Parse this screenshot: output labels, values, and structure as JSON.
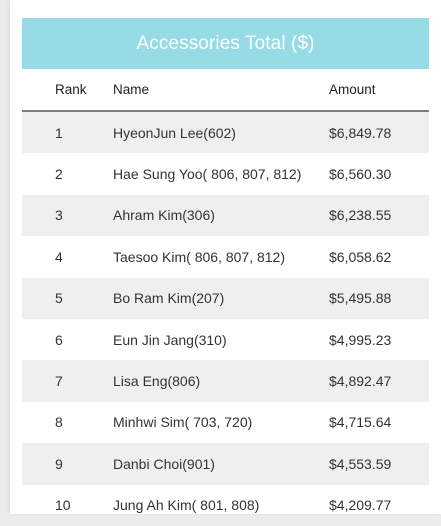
{
  "title": "Accessories Total ($)",
  "columns": {
    "rank": "Rank",
    "name": "Name",
    "amount": "Amount"
  },
  "rows": [
    {
      "rank": "1",
      "name": "HyeonJun Lee(602)",
      "amount": "$6,849.78"
    },
    {
      "rank": "2",
      "name": "Hae Sung Yoo( 806, 807, 812)",
      "amount": "$6,560.30"
    },
    {
      "rank": "3",
      "name": "Ahram Kim(306)",
      "amount": "$6,238.55"
    },
    {
      "rank": "4",
      "name": "Taesoo Kim( 806, 807, 812)",
      "amount": "$6,058.62"
    },
    {
      "rank": "5",
      "name": "Bo Ram Kim(207)",
      "amount": "$5,495.88"
    },
    {
      "rank": "6",
      "name": "Eun Jin Jang(310)",
      "amount": "$4,995.23"
    },
    {
      "rank": "7",
      "name": "Lisa Eng(806)",
      "amount": "$4,892.47"
    },
    {
      "rank": "8",
      "name": "Minhwi Sim( 703, 720)",
      "amount": "$4,715.64"
    },
    {
      "rank": "9",
      "name": "Danbi Choi(901)",
      "amount": "$4,553.59"
    },
    {
      "rank": "10",
      "name": "Jung Ah Kim( 801, 808)",
      "amount": "$4,209.77"
    }
  ],
  "colors": {
    "banner": "#96dbe5",
    "shaded_row": "#efefef",
    "header_rule": "#7d7d7d"
  }
}
